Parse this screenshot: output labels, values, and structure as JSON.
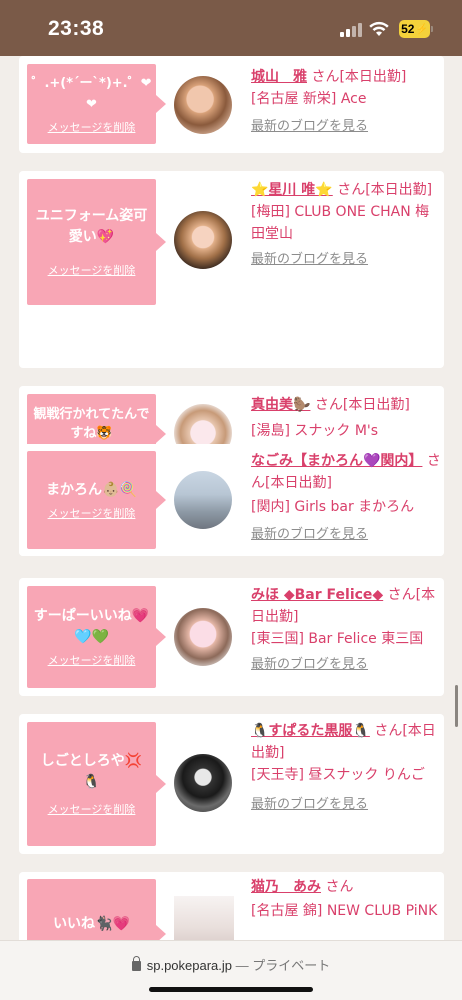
{
  "status_bar": {
    "time": "23:38",
    "battery": "52"
  },
  "delete_label": "メッセージを削除",
  "blog_label": "最新のブログを見る",
  "cards": [
    {
      "message": "゜.+(*´ー`*)+.゜❤❤",
      "name": "城山　雅",
      "san": "さん[本日出勤]",
      "shop": "[名古屋 新栄] Ace"
    },
    {
      "message": "ユニフォーム姿可愛い💖",
      "name": "⭐星川 唯⭐",
      "san": "さん[本日出勤]",
      "shop": "[梅田] CLUB ONE CHAN 梅田堂山"
    },
    {
      "message": "観戦行かれてたんですね🐯",
      "name": "真由美🦫",
      "san": "さん[本日出勤]",
      "shop": "[湯島] スナック M's"
    },
    {
      "message": "まかろん👶🏼🍭",
      "name": "なごみ【まかろん💜関内】",
      "san": "さん[本日出勤]",
      "shop": "[関内] Girls bar まかろん"
    },
    {
      "message": "すーぱーいいね💗🩵💚",
      "name": "みほ ◆Bar Felice◆",
      "san": "さん[本日出勤]",
      "shop": "[東三国] Bar Felice 東三国"
    },
    {
      "message": "しごとしろや💢🐧",
      "name": "🐧すぱるた黒服🐧",
      "san": "さん[本日出勤]",
      "shop": "[天王寺] 昼スナック りんご"
    },
    {
      "message": "いいね🐈‍⬛💗",
      "name": "猫乃　あみ",
      "san": "さん",
      "shop": "[名古屋 錦] NEW CLUB PiNK"
    }
  ],
  "browser": {
    "domain": "sp.pokepara.jp",
    "suffix": " — プライベート"
  }
}
